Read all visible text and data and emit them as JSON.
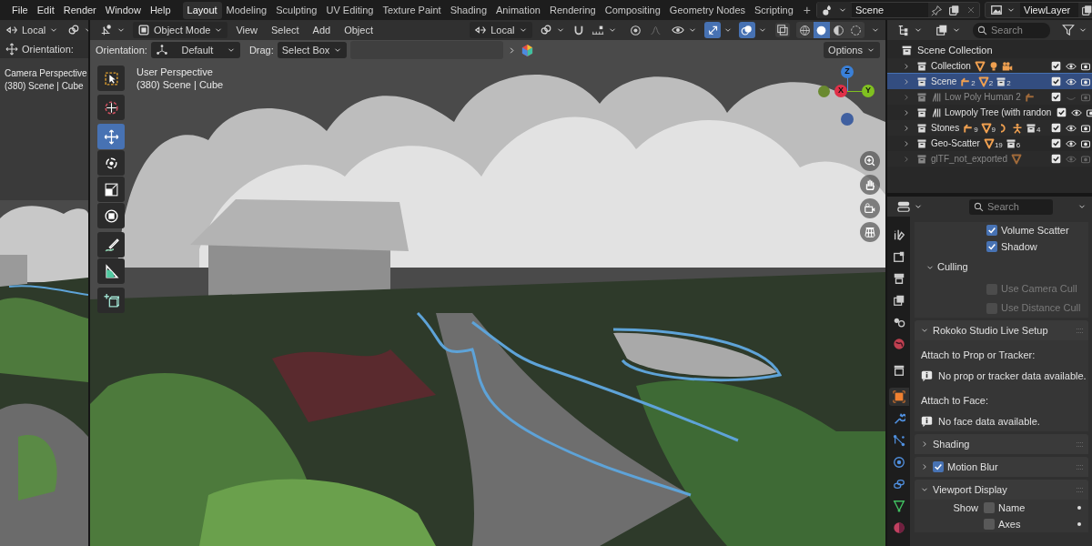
{
  "menu_bar": {
    "items": [
      "File",
      "Edit",
      "Render",
      "Window",
      "Help"
    ]
  },
  "workspace_tabs": [
    {
      "label": "Layout",
      "selected": true
    },
    {
      "label": "Modeling",
      "selected": false
    },
    {
      "label": "Sculpting",
      "selected": false
    },
    {
      "label": "UV Editing",
      "selected": false
    },
    {
      "label": "Texture Paint",
      "selected": false
    },
    {
      "label": "Shading",
      "selected": false
    },
    {
      "label": "Animation",
      "selected": false
    },
    {
      "label": "Rendering",
      "selected": false
    },
    {
      "label": "Compositing",
      "selected": false
    },
    {
      "label": "Geometry Nodes",
      "selected": false
    },
    {
      "label": "Scripting",
      "selected": false
    }
  ],
  "add_workspace": "+",
  "scene_selector": {
    "value": "Scene"
  },
  "view_layer_selector": {
    "value": "ViewLayer"
  },
  "left_viewport": {
    "transform_orientation": "Local",
    "orientation_label": "Orientation:",
    "title": "Camera Perspective",
    "subtitle": "(380) Scene | Cube"
  },
  "viewport": {
    "mode": "Object Mode",
    "menus": [
      "View",
      "Select",
      "Add",
      "Object"
    ],
    "transform_orientation": "Local",
    "orientation_label": "Orientation:",
    "orientation_value": "Default",
    "drag_label": "Drag:",
    "drag_value": "Select Box",
    "options": "Options",
    "title": "User Perspective",
    "subtitle": "(380) Scene | Cube",
    "show_gizmo": true,
    "show_overlays": true,
    "shading_modes": [
      {
        "selected": false
      },
      {
        "selected": true
      },
      {
        "selected": false
      },
      {
        "selected": false
      }
    ],
    "tools": [
      {
        "selected": false
      },
      {
        "selected": false
      },
      {
        "selected": true
      },
      {
        "selected": false
      },
      {
        "selected": false
      },
      {
        "selected": false
      },
      {
        "selected": false
      },
      {
        "selected": false
      },
      {
        "selected": false
      }
    ],
    "gizmo_axes": [
      "Z",
      "X",
      "Y"
    ]
  },
  "outliner": {
    "search_placeholder": "Search",
    "rows": [
      {
        "label": "Scene Collection",
        "children": [
          {
            "label": "Collection",
            "selected": false,
            "dimmed": false,
            "expanded": false,
            "checked": true,
            "visible": true,
            "badges": [
              {
                "kind": "mesh"
              },
              {
                "kind": "light"
              },
              {
                "kind": "camera"
              }
            ]
          },
          {
            "label": "Scene",
            "selected": true,
            "dimmed": false,
            "expanded": false,
            "checked": true,
            "visible": true,
            "badges": [
              {
                "kind": "empty",
                "count": "2"
              },
              {
                "kind": "mesh",
                "count": "2"
              },
              {
                "kind": "collection",
                "count": "2"
              }
            ]
          },
          {
            "label": "Low Poly Human 2",
            "selected": false,
            "dimmed": true,
            "expanded": false,
            "checked": true,
            "visible": false,
            "linked": true,
            "badges": [
              {
                "kind": "empty"
              }
            ]
          },
          {
            "label": "Lowpoly Tree (with randon",
            "selected": false,
            "dimmed": false,
            "expanded": false,
            "checked": true,
            "visible": true,
            "linked": true
          },
          {
            "label": "Stones",
            "selected": false,
            "dimmed": false,
            "expanded": false,
            "checked": true,
            "visible": true,
            "badges": [
              {
                "kind": "empty",
                "count": "9"
              },
              {
                "kind": "mesh",
                "count": "9"
              },
              {
                "kind": "hook"
              },
              {
                "kind": "armature"
              },
              {
                "kind": "collection",
                "count": "4"
              }
            ]
          },
          {
            "label": "Geo-Scatter",
            "selected": false,
            "dimmed": false,
            "expanded": false,
            "checked": true,
            "visible": true,
            "badges": [
              {
                "kind": "mesh",
                "count": "19"
              },
              {
                "kind": "collection",
                "count": "6"
              }
            ]
          },
          {
            "label": "glTF_not_exported",
            "selected": false,
            "dimmed": true,
            "expanded": false,
            "checked": true,
            "visible": true,
            "badges": [
              {
                "kind": "mesh"
              }
            ]
          }
        ]
      }
    ]
  },
  "properties": {
    "search_placeholder": "Search",
    "tabs": [
      {
        "selected": false
      },
      {
        "selected": false
      },
      {
        "selected": false
      },
      {
        "selected": false
      },
      {
        "selected": false
      },
      {
        "selected": false
      },
      {
        "selected": false
      },
      {
        "selected": true
      },
      {
        "selected": false
      },
      {
        "selected": false
      },
      {
        "selected": false
      },
      {
        "selected": false
      },
      {
        "selected": false
      },
      {
        "selected": false
      }
    ],
    "items": [
      {
        "kind": "checkbox",
        "label": "Volume Scatter",
        "checked": true,
        "disabled": false
      },
      {
        "kind": "checkbox",
        "label": "Shadow",
        "checked": true,
        "disabled": false
      },
      {
        "kind": "subpanel",
        "label": "Culling",
        "expanded": true
      },
      {
        "kind": "checkbox",
        "label": "Use Camera Cull",
        "checked": false,
        "disabled": true
      },
      {
        "kind": "checkbox",
        "label": "Use Distance Cull",
        "checked": false,
        "disabled": true
      },
      {
        "kind": "panel",
        "label": "Rokoko Studio Live Setup",
        "expanded": true
      },
      {
        "kind": "label",
        "text": "Attach to Prop or Tracker:"
      },
      {
        "kind": "info",
        "text": "No prop or tracker data available."
      },
      {
        "kind": "label",
        "text": "Attach to Face:"
      },
      {
        "kind": "info",
        "text": "No face data available."
      },
      {
        "kind": "panel",
        "label": "Shading",
        "expanded": false
      },
      {
        "kind": "panel",
        "label": "Motion Blur",
        "expanded": false,
        "checked": true
      },
      {
        "kind": "panel",
        "label": "Viewport Display",
        "expanded": true
      },
      {
        "kind": "show_row",
        "label": "Show",
        "checkbox_label": "Name",
        "checked": false
      },
      {
        "kind": "show_row",
        "checkbox_label": "Axes",
        "checked": false
      }
    ]
  }
}
